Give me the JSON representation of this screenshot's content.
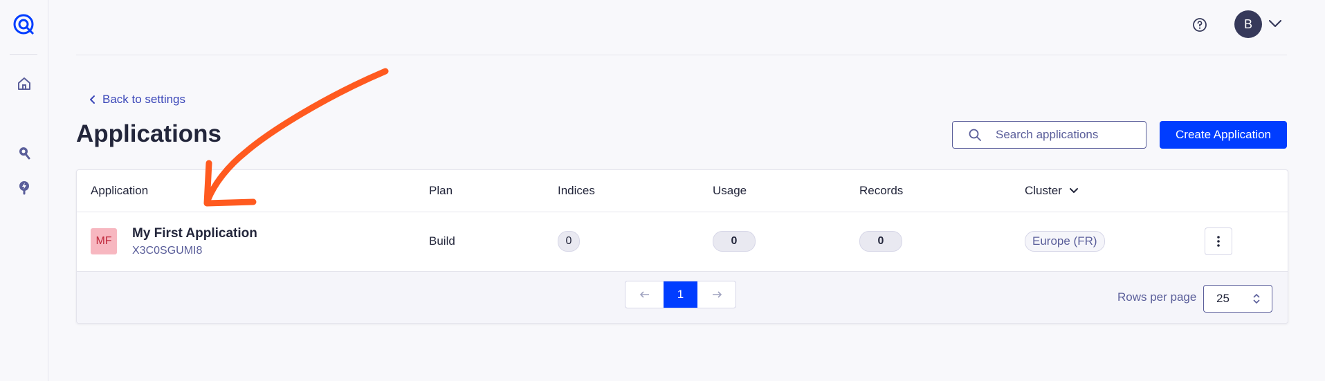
{
  "colors": {
    "accent": "#003dff",
    "annotation": "#ff5a1f",
    "badge_bg": "#f7b7c0",
    "badge_text": "#c0293d"
  },
  "sidebar": {
    "items": [
      {
        "icon": "home-icon"
      },
      {
        "icon": "search-insights-icon"
      },
      {
        "icon": "bolt-icon"
      }
    ]
  },
  "header": {
    "avatar_initial": "B"
  },
  "back_link": "Back to settings",
  "page_title": "Applications",
  "search": {
    "placeholder": "Search applications"
  },
  "create_button": "Create Application",
  "table": {
    "columns": {
      "application": "Application",
      "plan": "Plan",
      "indices": "Indices",
      "usage": "Usage",
      "records": "Records",
      "cluster": "Cluster"
    },
    "rows": [
      {
        "badge": "MF",
        "name": "My First Application",
        "id": "X3C0SGUMI8",
        "plan": "Build",
        "indices": "0",
        "usage": "0",
        "records": "0",
        "cluster": "Europe (FR)"
      }
    ]
  },
  "pagination": {
    "current_page": "1",
    "rows_per_page_label": "Rows per page",
    "rows_per_page": "25"
  }
}
